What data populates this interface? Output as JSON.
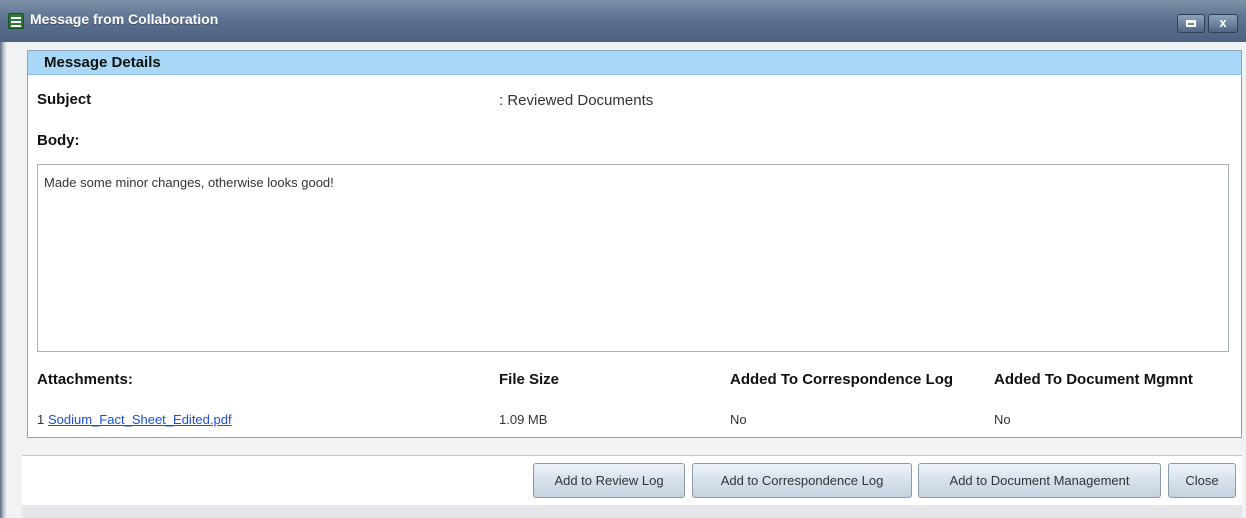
{
  "window": {
    "title": "Message from Collaboration",
    "close_label": "x"
  },
  "panel": {
    "header": "Message Details",
    "subject_label": "Subject",
    "subject_value": ":  Reviewed Documents",
    "body_label": "Body:",
    "body_text": "Made some minor changes, otherwise looks good!"
  },
  "attachments": {
    "headers": {
      "name": "Attachments:",
      "size": "File Size",
      "corr_log": "Added To Correspondence Log",
      "doc_mgmt": "Added To Document Mgmnt"
    },
    "rows": [
      {
        "index": "1",
        "file_name": "Sodium_Fact_Sheet_Edited.pdf",
        "file_size": "1.09 MB",
        "added_corr_log": "No",
        "added_doc_mgmt": "No"
      }
    ]
  },
  "buttons": {
    "review_log": "Add to Review Log",
    "correspondence_log": "Add to Correspondence Log",
    "document_management": "Add to Document Management",
    "close": "Close"
  },
  "icons": {
    "title_icon": "form-icon",
    "maximize_icon": "maximize-icon",
    "close_icon": "close-icon"
  },
  "colors": {
    "titlebar": "#5d7290",
    "panel_header": "#a8d8f5",
    "link": "#1a4fd6"
  }
}
